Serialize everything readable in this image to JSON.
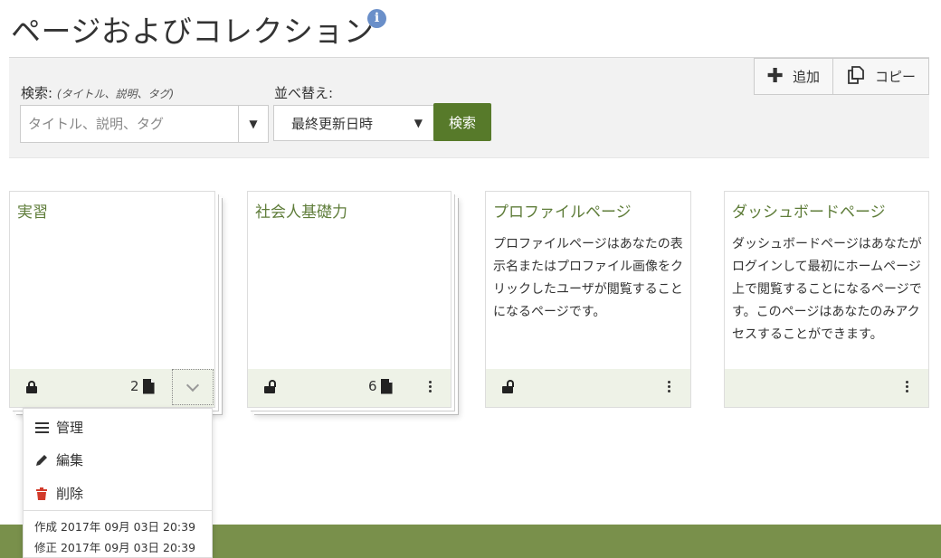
{
  "header": {
    "title": "ページおよびコレクション",
    "info_icon": "i"
  },
  "toolbar": {
    "add_label": "追加",
    "copy_label": "コピー"
  },
  "search": {
    "label": "検索:",
    "hint": "(タイトル、説明、タグ)",
    "placeholder": "タイトル、説明、タグ",
    "sort_label": "並べ替え:",
    "sort_value": "最終更新日時",
    "button_label": "検索"
  },
  "cards": [
    {
      "title": "実習",
      "description": "",
      "count": "2",
      "locked": true
    },
    {
      "title": "社会人基礎力",
      "description": "",
      "count": "6",
      "locked": false
    },
    {
      "title": "プロファイルページ",
      "description": "プロファイルページはあなたの表示名またはプロファイル画像をクリックしたユーザが閲覧することになるページです。",
      "locked": false
    },
    {
      "title": "ダッシュボードページ",
      "description": "ダッシュボードページはあなたがログインして最初にホームページ上で閲覧することになるページです。このページはあなたのみアクセスすることができます。",
      "locked": null
    }
  ],
  "menu": {
    "manage": "管理",
    "edit": "編集",
    "delete": "削除",
    "created": "作成 2017年 09月 03日 20:39",
    "modified": "修正 2017年 09月 03日 20:39"
  },
  "colors": {
    "accent": "#577a2a",
    "title_green": "#5f7d3a",
    "footer": "#79904b",
    "card_footer": "#eef2e7"
  }
}
